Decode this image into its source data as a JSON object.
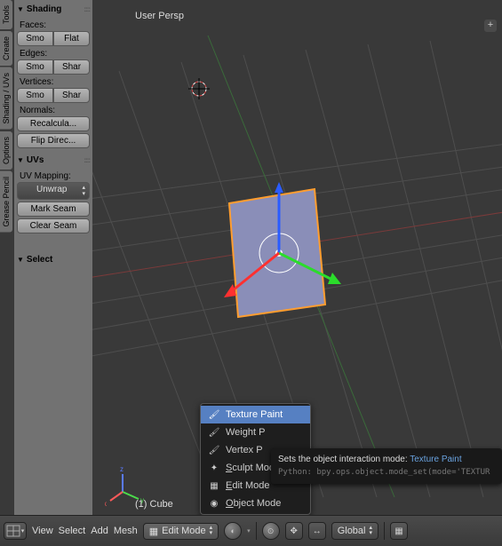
{
  "vtabs": [
    "Tools",
    "Create",
    "Shading / UVs",
    "Options",
    "Grease Pencil"
  ],
  "shading": {
    "title": "Shading",
    "faces_label": "Faces:",
    "smooth": "Smo",
    "flat": "Flat",
    "edges_label": "Edges:",
    "edge_smooth": "Smo",
    "edge_sharp": "Shar",
    "verts_label": "Vertices:",
    "vert_smooth": "Smo",
    "vert_sharp": "Shar",
    "normals_label": "Normals:",
    "recalc": "Recalcula...",
    "flip": "Flip Direc..."
  },
  "uvs": {
    "title": "UVs",
    "mapping_label": "UV Mapping:",
    "unwrap": "Unwrap",
    "mark_seam": "Mark Seam",
    "clear_seam": "Clear Seam"
  },
  "select_panel": {
    "title": "Select"
  },
  "viewport": {
    "persp_label": "User Persp",
    "object_name": "(1) Cube"
  },
  "mode_menu": {
    "items": [
      {
        "label": "Texture Paint",
        "icon": "🖌"
      },
      {
        "label": "Weight Paint",
        "icon": "🖌",
        "clip": "Weight P"
      },
      {
        "label": "Vertex Paint",
        "icon": "🖌",
        "clip": "Vertex P"
      },
      {
        "label": "Sculpt Mode",
        "icon": "✦",
        "ul": "S"
      },
      {
        "label": "Edit Mode",
        "icon": "▦",
        "ul": "E"
      },
      {
        "label": "Object Mode",
        "icon": "◉",
        "ul": "O"
      }
    ],
    "highlighted_index": 0
  },
  "tooltip": {
    "desc": "Sets the object interaction mode:",
    "value": "Texture Paint",
    "python": "Python: bpy.ops.object.mode_set(mode='TEXTUR"
  },
  "header": {
    "menus": [
      "View",
      "Select",
      "Add",
      "Mesh"
    ],
    "mode_label": "Edit Mode",
    "orientation": "Global"
  }
}
